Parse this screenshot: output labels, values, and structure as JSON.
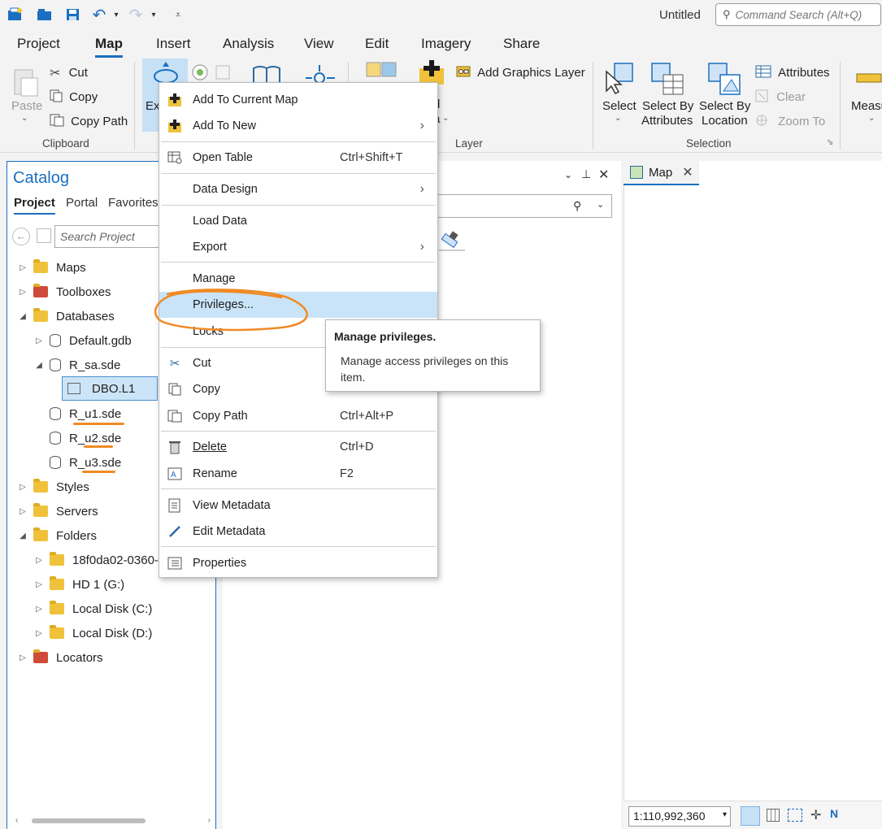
{
  "app": {
    "title": "Untitled"
  },
  "command_search": {
    "placeholder": "Command Search (Alt+Q)"
  },
  "ribbon_tabs": [
    "Project",
    "Map",
    "Insert",
    "Analysis",
    "View",
    "Edit",
    "Imagery",
    "Share"
  ],
  "active_tab": "Map",
  "ribbon": {
    "clipboard": {
      "paste": "Paste",
      "cut": "Cut",
      "copy": "Copy",
      "copy_path": "Copy Path",
      "group": "Clipboard"
    },
    "explore_partial": "Ex",
    "add_graphics_layer": "Add Graphics Layer",
    "layer_partial_1": "d",
    "layer_partial_2": "a",
    "layer_group": "Layer",
    "selection": {
      "select": "Select",
      "select_by_attributes_1": "Select By",
      "select_by_attributes_2": "Attributes",
      "select_by_location_1": "Select By",
      "select_by_location_2": "Location",
      "attributes": "Attributes",
      "clear": "Clear",
      "zoom_to": "Zoom To",
      "group": "Selection"
    },
    "measure_partial": "Measu"
  },
  "catalog": {
    "title": "Catalog",
    "tabs": [
      "Project",
      "Portal",
      "Favorites"
    ],
    "search_placeholder": "Search Project",
    "tree": [
      {
        "label": "Maps"
      },
      {
        "label": "Toolboxes"
      },
      {
        "label": "Databases"
      },
      {
        "label": "Default.gdb"
      },
      {
        "label": "R_sa.sde"
      },
      {
        "label": "DBO.L1"
      },
      {
        "label": "R_u1.sde"
      },
      {
        "label": "R_u2.sde"
      },
      {
        "label": "R_u3.sde"
      },
      {
        "label": "Styles"
      },
      {
        "label": "Servers"
      },
      {
        "label": "Folders"
      },
      {
        "label": "18f0da02-0360-"
      },
      {
        "label": "HD 1 (G:)"
      },
      {
        "label": "Local Disk (C:)"
      },
      {
        "label": "Local Disk (D:)"
      },
      {
        "label": "Locators"
      }
    ]
  },
  "map_tab": {
    "label": "Map"
  },
  "status": {
    "scale": "1:110,992,360"
  },
  "context_menu": {
    "items": [
      {
        "label": "Add To Current Map",
        "shortcut": ""
      },
      {
        "label": "Add To New",
        "shortcut": ""
      },
      {
        "label": "Open Table",
        "shortcut": "Ctrl+Shift+T"
      },
      {
        "label": "Data Design",
        "shortcut": ""
      },
      {
        "label": "Load Data",
        "shortcut": ""
      },
      {
        "label": "Export",
        "shortcut": ""
      },
      {
        "label": "Manage",
        "shortcut": ""
      },
      {
        "label": "Privileges...",
        "shortcut": ""
      },
      {
        "label": "Locks",
        "shortcut": ""
      },
      {
        "label": "Cut",
        "shortcut": ""
      },
      {
        "label": "Copy",
        "shortcut": ""
      },
      {
        "label": "Copy Path",
        "shortcut": "Ctrl+Alt+P"
      },
      {
        "label": "Delete",
        "shortcut": "Ctrl+D"
      },
      {
        "label": "Rename",
        "shortcut": "F2"
      },
      {
        "label": "View Metadata",
        "shortcut": ""
      },
      {
        "label": "Edit Metadata",
        "shortcut": ""
      },
      {
        "label": "Properties",
        "shortcut": ""
      }
    ]
  },
  "tooltip": {
    "title": "Manage privileges.",
    "description": "Manage access privileges on this item."
  },
  "colors": {
    "accent": "#1a6fc0",
    "highlight": "#c9e4f8",
    "annotation": "#f08a24"
  }
}
